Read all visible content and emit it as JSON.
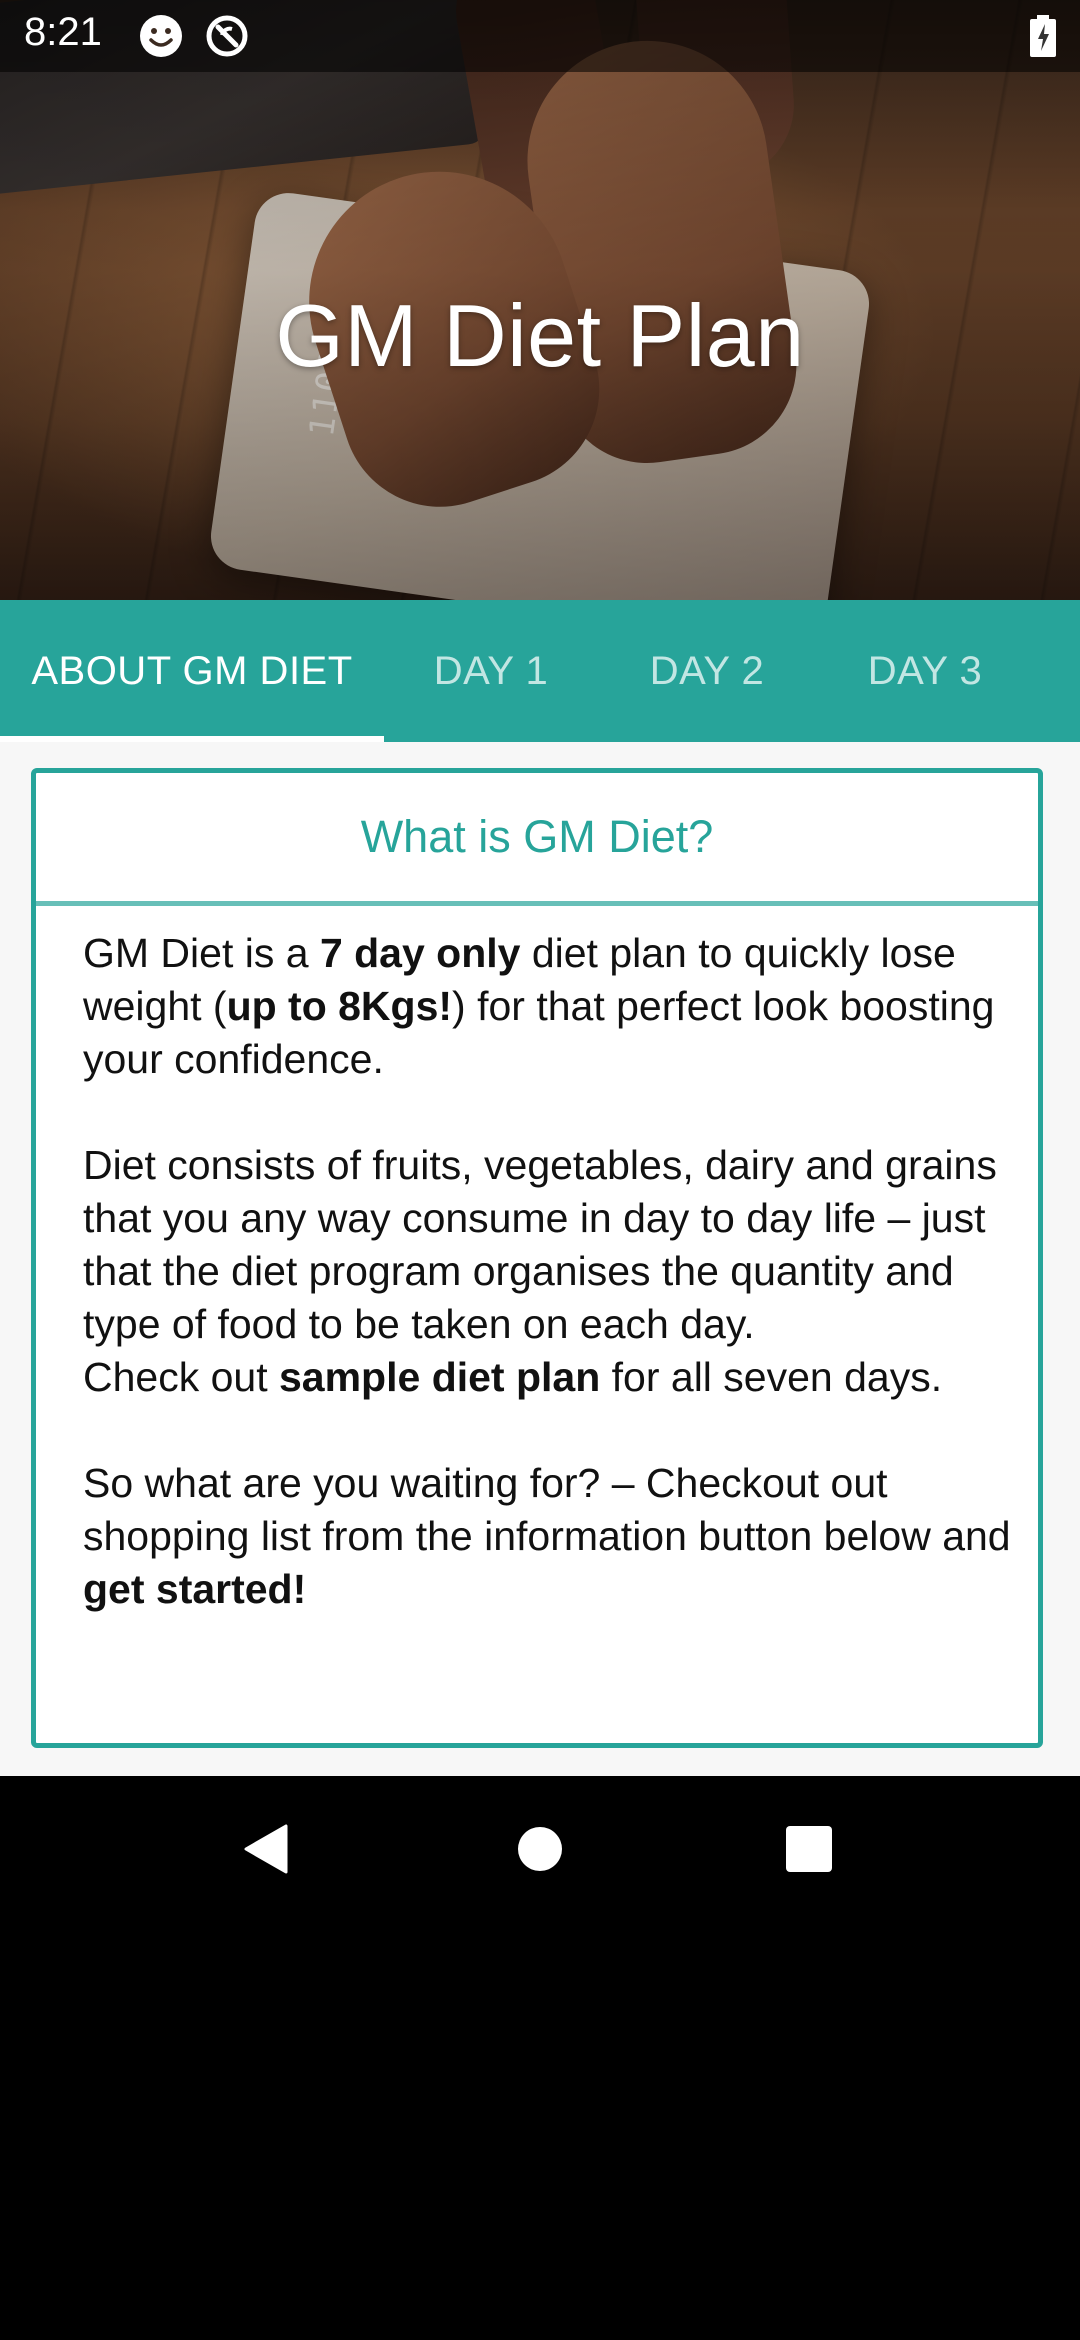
{
  "status_bar": {
    "time": "8:21",
    "icons": [
      "face-icon",
      "sync-icon",
      "battery-charging-icon"
    ]
  },
  "hero": {
    "title": "GM Diet Plan",
    "scale_display": "1103"
  },
  "tabs": [
    {
      "label": "ABOUT GM DIET",
      "active": true
    },
    {
      "label": "DAY 1",
      "active": false
    },
    {
      "label": "DAY 2",
      "active": false
    },
    {
      "label": "DAY 3",
      "active": false
    }
  ],
  "card": {
    "title": "What is GM Diet?",
    "p1": {
      "t1": "GM Diet is a ",
      "b1": "7 day only",
      "t2": " diet plan to quickly lose weight (",
      "b2": "up to 8Kgs!",
      "t3": ") for that perfect look boosting your confidence."
    },
    "p2": "Diet consists of fruits, vegetables, dairy and grains that you any way consume in day to day life – just that the diet program organises the quantity and type of food to be taken on each day.",
    "p3": {
      "t1": "Check out ",
      "b1": "sample diet plan",
      "t2": " for all seven days."
    },
    "p4": {
      "t1": "So what are you waiting for? – Checkout out shopping list from the information button below and ",
      "b1": "get started!"
    }
  },
  "colors": {
    "accent": "#27a49a",
    "status_bar": "#000000",
    "nav_bar": "#000000"
  },
  "nav_bar": {
    "buttons": [
      "back-icon",
      "home-icon",
      "recents-icon"
    ]
  }
}
